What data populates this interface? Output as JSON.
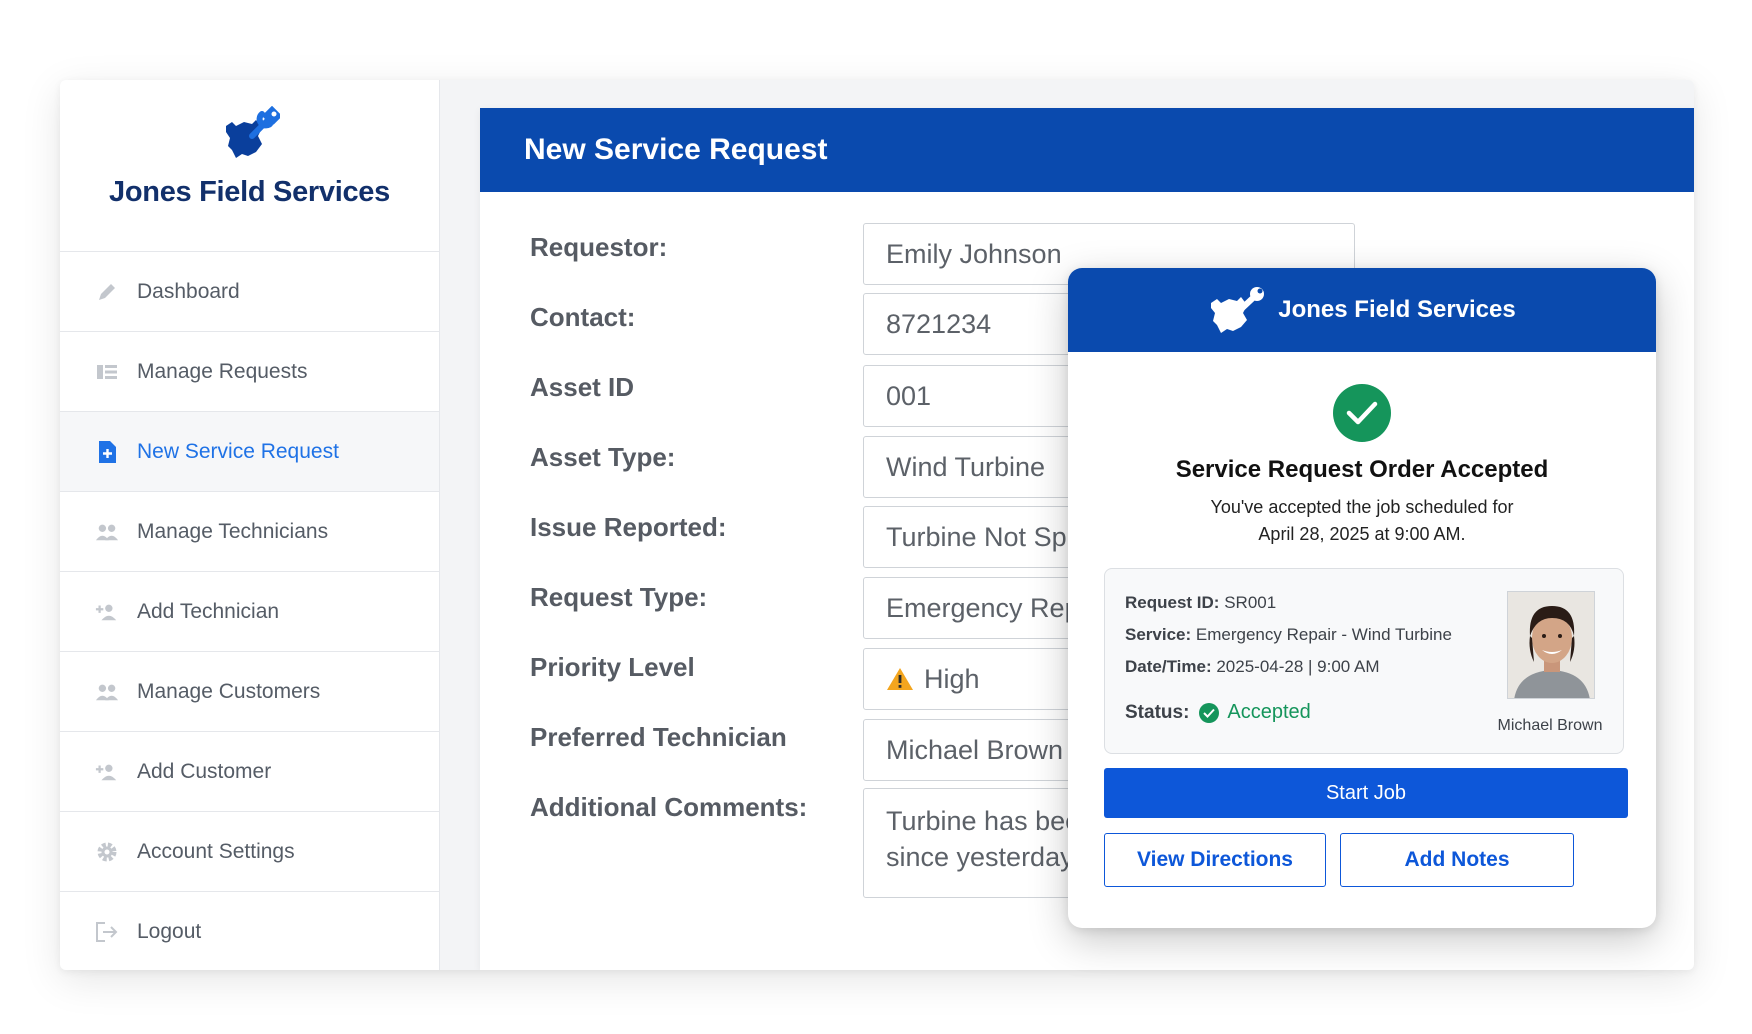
{
  "brand": {
    "name": "Jones Field Services"
  },
  "colors": {
    "primary": "#0a4aae",
    "accent": "#0d57d9",
    "success": "#15955b",
    "active_nav": "#1f72e6"
  },
  "sidebar": {
    "items": [
      {
        "label": "Dashboard",
        "icon": "pencil-icon"
      },
      {
        "label": "Manage Requests",
        "icon": "list-icon"
      },
      {
        "label": "New Service Request",
        "icon": "new-document-icon",
        "active": true
      },
      {
        "label": "Manage Technicians",
        "icon": "users-icon"
      },
      {
        "label": "Add Technician",
        "icon": "add-user-icon"
      },
      {
        "label": "Manage Customers",
        "icon": "users-icon"
      },
      {
        "label": "Add Customer",
        "icon": "add-user-icon"
      },
      {
        "label": "Account Settings",
        "icon": "gear-icon"
      },
      {
        "label": "Logout",
        "icon": "logout-icon"
      }
    ]
  },
  "form": {
    "title": "New Service Request",
    "fields": [
      {
        "label": "Requestor:",
        "value": "Emily Johnson"
      },
      {
        "label": "Contact:",
        "value": "8721234"
      },
      {
        "label": "Asset ID",
        "value": "001"
      },
      {
        "label": "Asset Type:",
        "value": "Wind Turbine"
      },
      {
        "label": "Issue Reported:",
        "value": "Turbine Not Spi"
      },
      {
        "label": "Request Type:",
        "value": "Emergency Rep"
      },
      {
        "label": "Priority Level",
        "value": "High"
      },
      {
        "label": "Preferred Technician",
        "value": "Michael Brown"
      },
      {
        "label": "Additional Comments:",
        "value_line1": "Turbine has bee",
        "value_line2": "since yesterday."
      }
    ]
  },
  "modal": {
    "brand": "Jones Field Services",
    "title": "Service Request Order Accepted",
    "message_line1": "You've accepted the job scheduled for",
    "message_line2": "April 28, 2025 at 9:00 AM.",
    "details": {
      "request_id_label": "Request ID:",
      "request_id": "SR001",
      "service_label": "Service:",
      "service": "Emergency Repair - Wind Turbine",
      "datetime_label": "Date/Time:",
      "datetime": "2025-04-28 | 9:00 AM",
      "status_label": "Status:",
      "status": "Accepted",
      "technician": "Michael Brown"
    },
    "buttons": {
      "start": "Start Job",
      "directions": "View Directions",
      "notes": "Add Notes"
    }
  }
}
